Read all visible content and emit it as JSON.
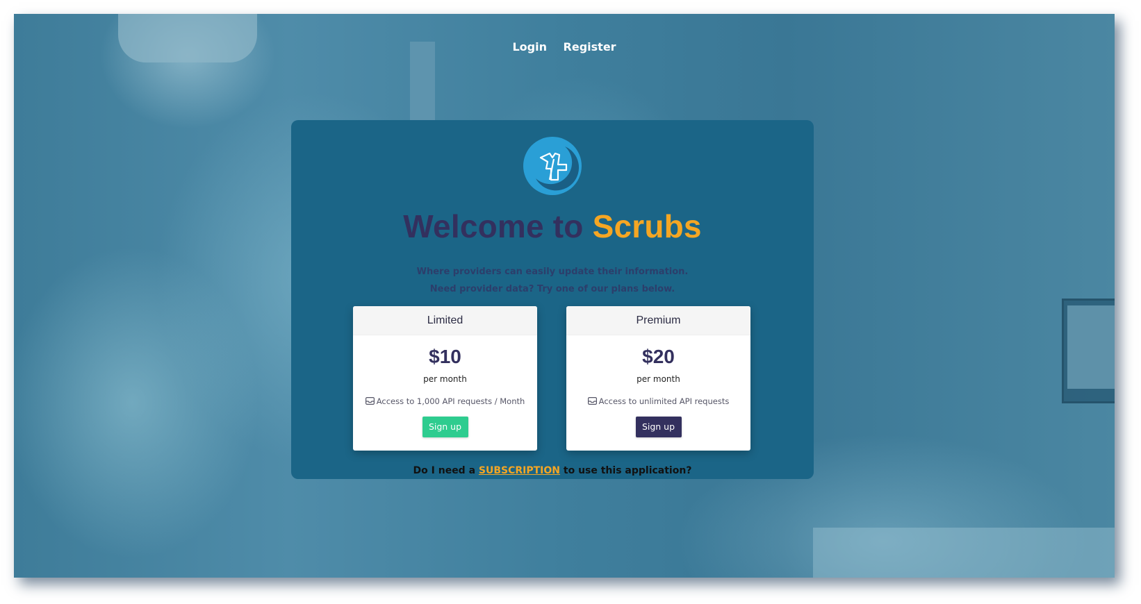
{
  "nav": {
    "login_label": "Login",
    "register_label": "Register"
  },
  "hero": {
    "title_prefix": "Welcome to",
    "title_brand": "Scrubs",
    "tagline_line1": "Where providers can easily update their information.",
    "tagline_line2": "Need provider data? Try one of our plans below."
  },
  "plans": [
    {
      "name": "Limited",
      "price": "$10",
      "period": "per month",
      "feature": "Access to 1,000 API requests / Month",
      "button_label": "Sign up",
      "button_color": "#2ecc8f"
    },
    {
      "name": "Premium",
      "price": "$20",
      "period": "per month",
      "feature": "Access to unlimited API requests",
      "button_label": "Sign up",
      "button_color": "#33305e"
    }
  ],
  "footer_question": {
    "prefix": "Do I need a",
    "link_label": "SUBSCRIPTION",
    "suffix": "to use this application?"
  },
  "colors": {
    "card_bg": "#1b6587",
    "title": "#33305e",
    "accent": "#f5a623"
  },
  "icons": {
    "logo": "scrubs-logo-icon",
    "feature": "inbox-icon"
  }
}
